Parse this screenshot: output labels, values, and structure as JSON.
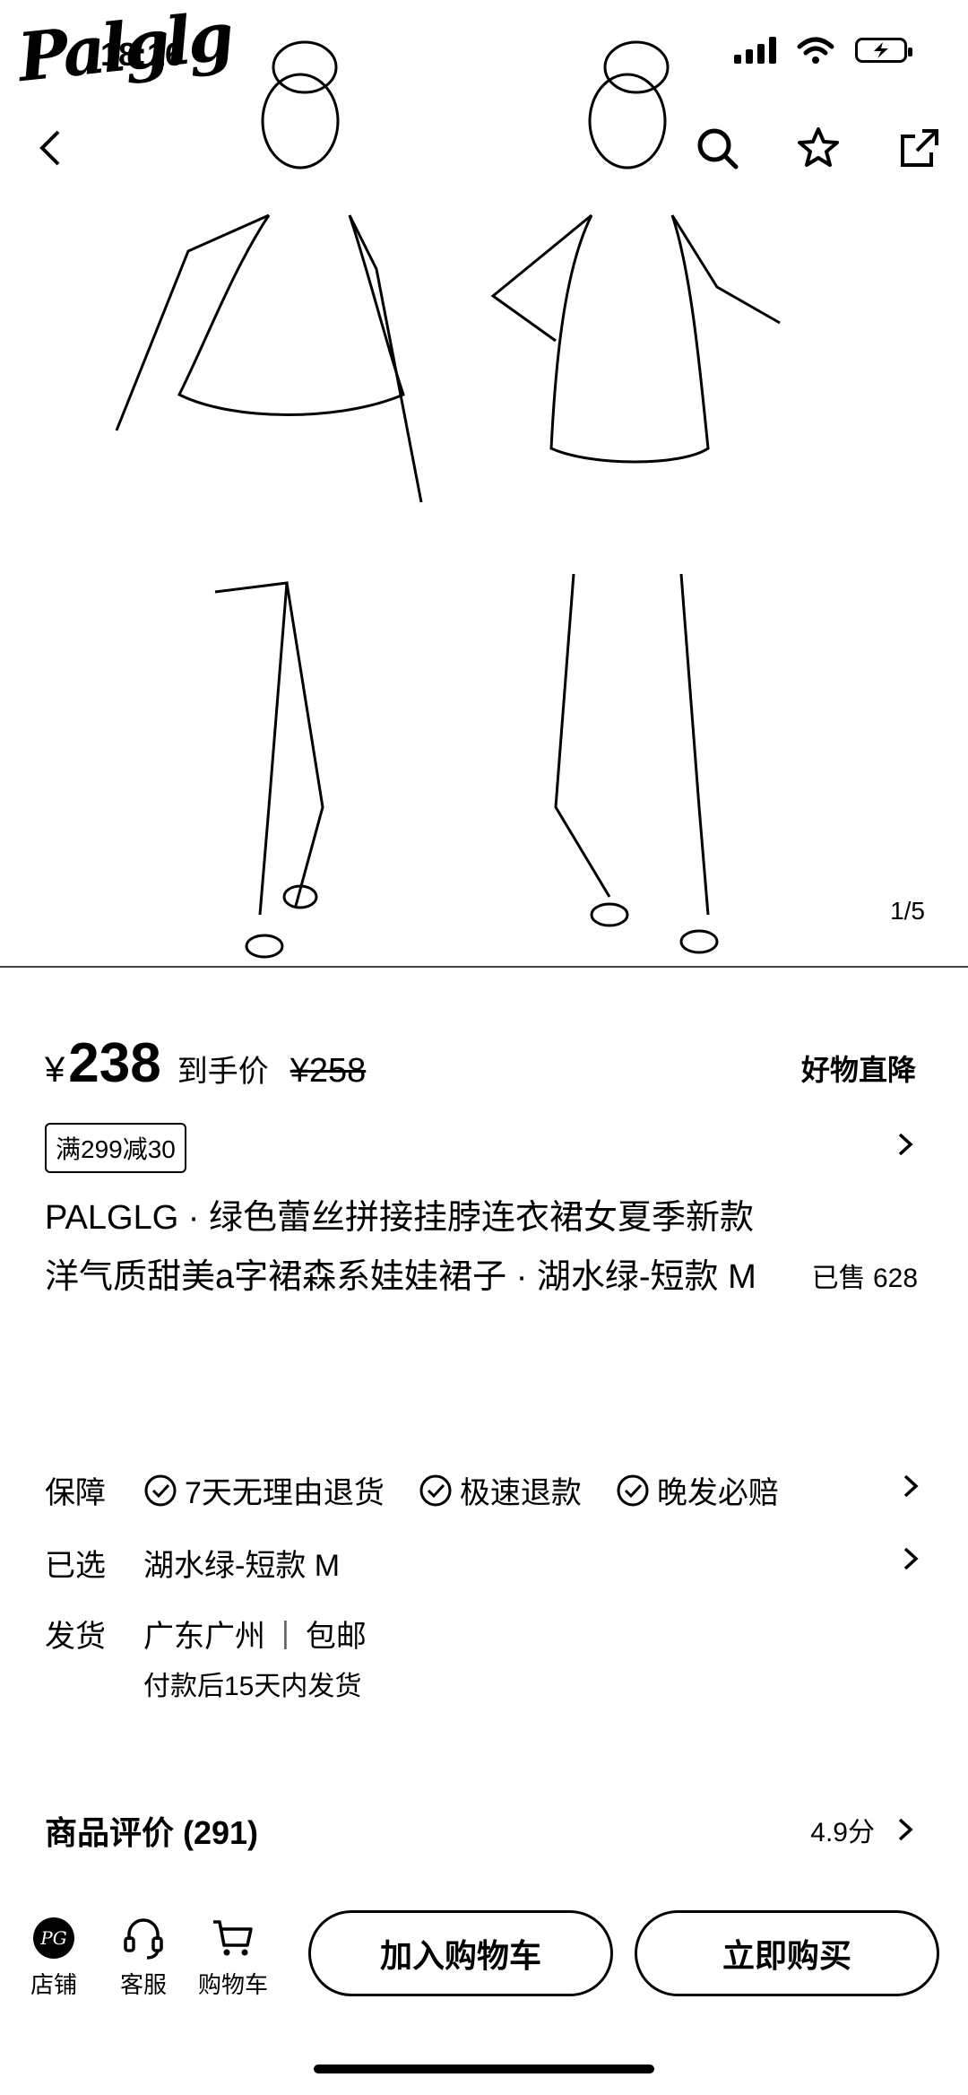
{
  "status_bar": {
    "brand": "Palglg",
    "time": "18:16"
  },
  "gallery": {
    "counter": "1/5"
  },
  "price": {
    "currency": "¥",
    "current": "238",
    "suffix": "到手价",
    "original": "¥258",
    "promo_tag": "好物直降"
  },
  "coupon": "满299减30",
  "product": {
    "title": "PALGLG · 绿色蕾丝拼接挂脖连衣裙女夏季新款洋气质甜美a字裙森系娃娃裙子 · 湖水绿-短款 M",
    "sold": "已售 628"
  },
  "guarantee": {
    "label": "保障",
    "items": [
      "7天无理由退货",
      "极速退款",
      "晚发必赔"
    ]
  },
  "selected": {
    "label": "已选",
    "value": "湖水绿-短款 M"
  },
  "shipping": {
    "label": "发货",
    "location": "广东广州",
    "separator": "|",
    "free": "包邮",
    "note": "付款后15天内发货"
  },
  "reviews": {
    "title": "商品评价 (291)",
    "score": "4.9分"
  },
  "bottom_bar": {
    "store": "店铺",
    "service": "客服",
    "cart": "购物车",
    "store_logo": "PG",
    "add_to_cart": "加入购物车",
    "buy_now": "立即购买"
  }
}
